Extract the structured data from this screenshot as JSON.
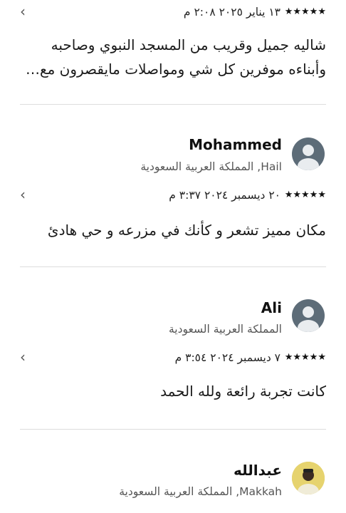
{
  "reviews": [
    {
      "stars": "★★★★★",
      "date": "١٣ يناير ٢٠٢٥ ٢:٠٨ م",
      "text": "شاليه جميل وقريب من المسجد النبوي وصاحبه وأبناءه موفرين كل شي ومواصلات مايقصرون مع…",
      "chevron": "‹"
    },
    {
      "name": "Mohammed",
      "location": "Hail, المملكة العربية السعودية",
      "avatar_icon": "default-user-avatar-icon",
      "stars": "★★★★★",
      "date": "٢٠ ديسمبر ٢٠٢٤ ٣:٣٧ م",
      "text": "مكان مميز تشعر و كأنك في مزرعه و حي هادئ",
      "chevron": "‹"
    },
    {
      "name": "Ali",
      "location": "المملكة العربية السعودية",
      "avatar_icon": "default-user-avatar-icon",
      "stars": "★★★★★",
      "date": "٧ ديسمبر ٢٠٢٤ ٣:٥٤ م",
      "text": "كانت تجربة رائعة ولله الحمد",
      "chevron": "‹"
    },
    {
      "name": "عبدالله",
      "location": "Makkah, المملكة العربية السعودية",
      "avatar_icon": "user-photo-avatar-icon"
    }
  ],
  "colors": {
    "divider": "#dddddd",
    "avatar_bg": "#5d6c78",
    "text": "#1a1a1a",
    "muted": "#555555"
  }
}
